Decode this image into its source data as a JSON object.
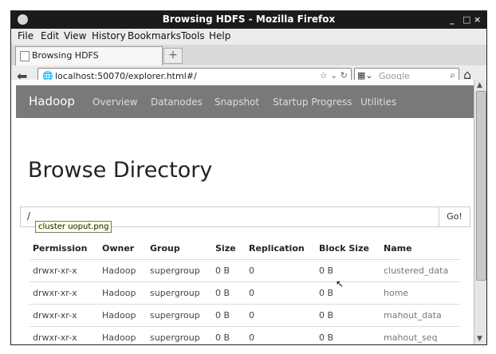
{
  "window": {
    "title": "Browsing HDFS - Mozilla Firefox",
    "controls": [
      "_",
      "□",
      "×"
    ]
  },
  "menu": [
    "File",
    "Edit",
    "View",
    "History",
    "Bookmarks",
    "Tools",
    "Help"
  ],
  "tab": {
    "label": "Browsing HDFS",
    "new_tab": "+"
  },
  "nav": {
    "url": "localhost:50070/explorer.html#/",
    "search_placeholder": "Google",
    "back_icon": "back-arrow-icon",
    "home_icon": "home-icon"
  },
  "hadoop_nav": {
    "brand": "Hadoop",
    "items": [
      "Overview",
      "Datanodes",
      "Snapshot",
      "Startup Progress",
      "Utilities"
    ]
  },
  "page": {
    "heading": "Browse Directory",
    "path": "/",
    "go_label": "Go!",
    "tooltip": "cluster uoput.png"
  },
  "table": {
    "headers": [
      "Permission",
      "Owner",
      "Group",
      "Size",
      "Replication",
      "Block Size",
      "Name"
    ],
    "rows": [
      [
        "drwxr-xr-x",
        "Hadoop",
        "supergroup",
        "0 B",
        "0",
        "0 B",
        "clustered_data"
      ],
      [
        "drwxr-xr-x",
        "Hadoop",
        "supergroup",
        "0 B",
        "0",
        "0 B",
        "home"
      ],
      [
        "drwxr-xr-x",
        "Hadoop",
        "supergroup",
        "0 B",
        "0",
        "0 B",
        "mahout_data"
      ],
      [
        "drwxr-xr-x",
        "Hadoop",
        "supergroup",
        "0 B",
        "0",
        "0 B",
        "mahout_seq"
      ]
    ]
  },
  "colors": {
    "nav_bg": "#797979",
    "title_bg": "#1b1b1b"
  }
}
